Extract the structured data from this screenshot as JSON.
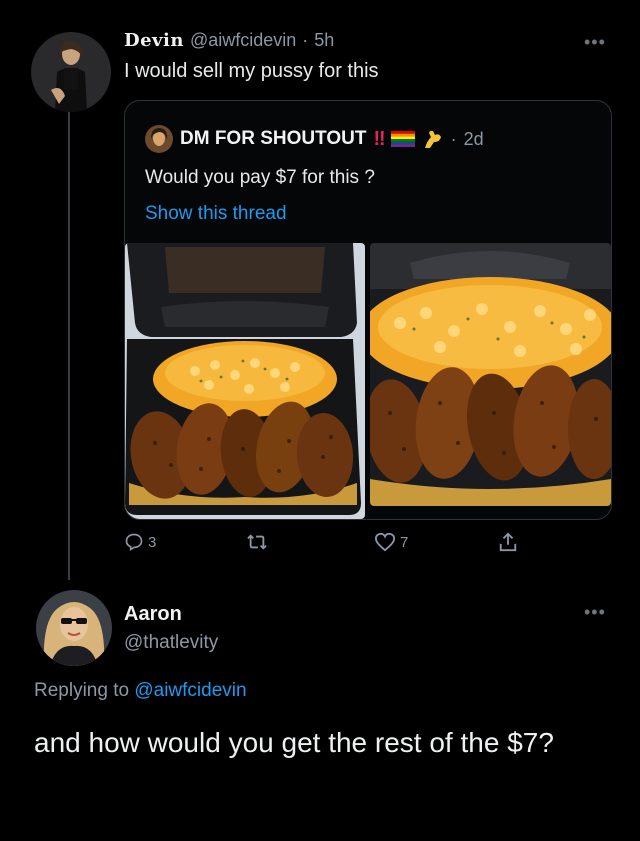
{
  "top_tweet": {
    "display_name": "Devin",
    "handle": "@aiwfcidevin",
    "separator": "·",
    "time": "5h",
    "text": "I would sell my pussy for this",
    "more_icon": "more-dots-icon"
  },
  "quoted_tweet": {
    "display_name": "DM FOR SHOUTOUT",
    "name_emoji": [
      "double-exclamation-icon",
      "rainbow-flag-icon",
      "flexed-biceps-icon"
    ],
    "separator": "·",
    "time": "2d",
    "text": "Would you pay $7 for this ?",
    "show_thread": "Show this thread"
  },
  "actions": {
    "reply_count": "3",
    "like_count": "7"
  },
  "reply_tweet": {
    "display_name": "Aaron",
    "handle": "@thatlevity",
    "replying_prefix": "Replying to",
    "replying_handle": "@aiwfcidevin",
    "text": "and how would you get the rest of the $7?"
  },
  "colors": {
    "background": "#000000",
    "link": "#1d9bf0",
    "muted": "#8b98a5"
  }
}
